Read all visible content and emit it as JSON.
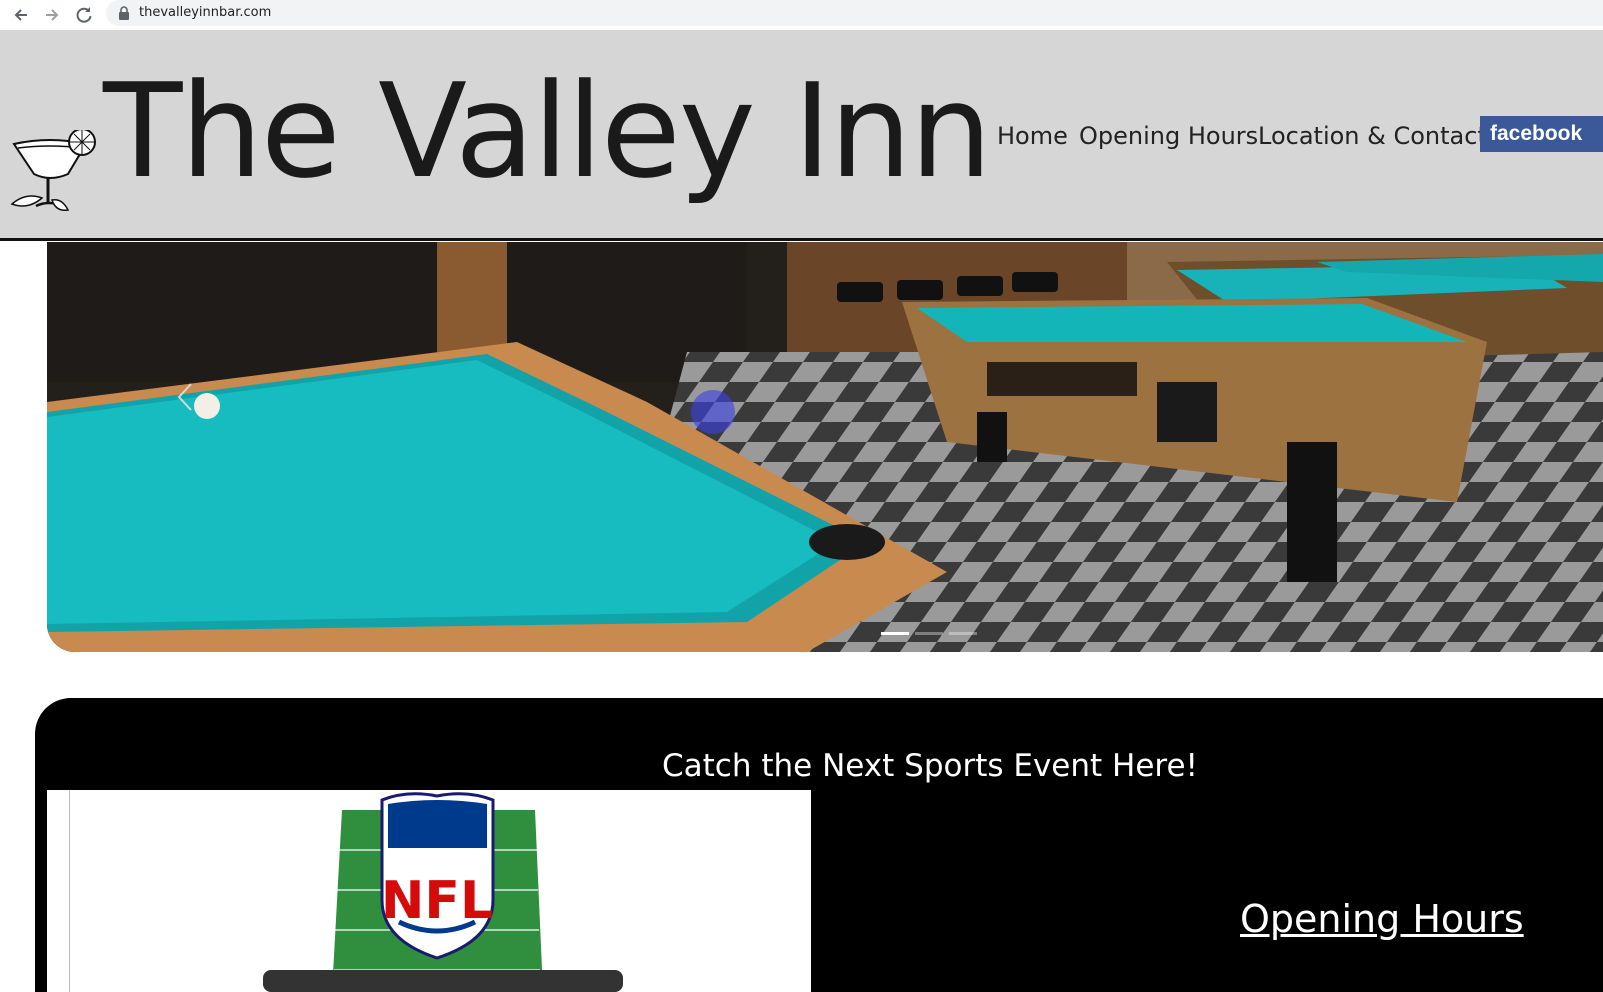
{
  "browser": {
    "url": "thevalleyinnbar.com",
    "back_icon": "arrow-left-icon",
    "forward_icon": "arrow-right-icon",
    "reload_icon": "reload-icon",
    "lock_icon": "lock-icon"
  },
  "header": {
    "site_title": "The Valley Inn",
    "logo_icon": "margarita-glass-icon",
    "nav": [
      "Home",
      "Opening Hours",
      "Location & Contact"
    ],
    "facebook_label": "facebook",
    "colors": {
      "header_bg": "#d7d6d7",
      "facebook_bg": "#3b5998"
    }
  },
  "hero": {
    "prev_icon": "chevron-left-icon",
    "slides_count": 3,
    "active_slide": 1
  },
  "sports": {
    "title": "Catch the Next Sports Event Here!",
    "nfl_logo_text": "NFL",
    "opening_hours_link": "Opening Hours"
  }
}
